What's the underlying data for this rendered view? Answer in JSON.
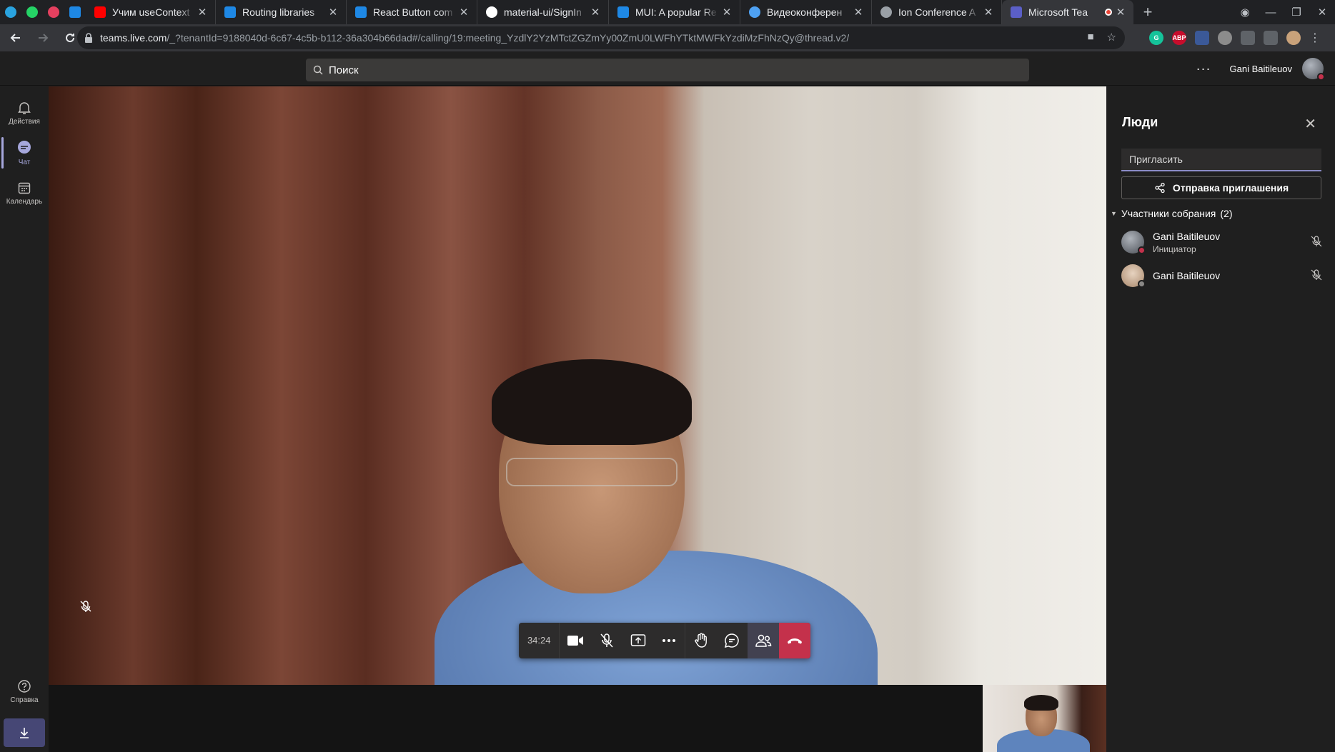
{
  "browser": {
    "pinned_tabs": [
      {
        "icon": "telegram-icon",
        "color": "#2aa3df"
      },
      {
        "icon": "whatsapp-icon",
        "color": "#25d366"
      },
      {
        "icon": "recorder-icon",
        "color": "#e4405f"
      },
      {
        "icon": "mui-icon",
        "color": "#1e88e5"
      }
    ],
    "tabs": [
      {
        "title": "Учим useContext",
        "icon": "youtube-icon",
        "color": "#ff0000"
      },
      {
        "title": "Routing libraries",
        "icon": "mui-icon",
        "color": "#1e88e5"
      },
      {
        "title": "React Button com",
        "icon": "mui-icon",
        "color": "#1e88e5"
      },
      {
        "title": "material-ui/SignIn",
        "icon": "github-icon",
        "color": "#ffffff"
      },
      {
        "title": "MUI: A popular Re",
        "icon": "mui-icon",
        "color": "#1e88e5"
      },
      {
        "title": "Видеоконферен",
        "icon": "videoconf-icon",
        "color": "#4ea1f3"
      },
      {
        "title": "Ion Conference A",
        "icon": "globe-icon",
        "color": "#9aa0a6"
      },
      {
        "title": "Microsoft Tea",
        "icon": "teams-icon",
        "color": "#5b5fc7",
        "active": true
      }
    ],
    "url_host": "teams.live.com",
    "url_path": "/_?tenantId=9188040d-6c67-4c5b-b112-36a304b66dad#/calling/19:meeting_YzdlY2YzMTctZGZmYy00ZmU0LWFhYTktMWFkYzdiMzFhNzQy@thread.v2/",
    "extensions": [
      {
        "icon": "grammarly-icon",
        "label": "G",
        "color": "#15c39a"
      },
      {
        "icon": "adblock-icon",
        "label": "ABP",
        "color": "#c70d2c"
      },
      {
        "icon": "devtools-icon",
        "label": "",
        "color": "#3b5998"
      },
      {
        "icon": "timer-icon",
        "label": "",
        "color": "#8c8c8c"
      },
      {
        "icon": "eyedropper-icon",
        "label": "",
        "color": "#5f6368"
      },
      {
        "icon": "puzzle-icon",
        "label": "",
        "color": "#5f6368"
      }
    ]
  },
  "teams": {
    "search_placeholder": "Поиск",
    "user_name": "Gani Baitileuov",
    "rail": [
      {
        "label": "Действия",
        "icon": "bell-icon"
      },
      {
        "label": "Чат",
        "icon": "chat-icon",
        "active": true
      },
      {
        "label": "Календарь",
        "icon": "calendar-icon"
      }
    ],
    "help_label": "Справка",
    "call": {
      "timer": "34:24"
    },
    "people": {
      "title": "Люди",
      "invite_placeholder": "Пригласить",
      "send_invite": "Отправка приглашения",
      "section_label": "Участники собрания",
      "section_count": "(2)",
      "members": [
        {
          "name": "Gani Baitileuov",
          "role": "Инициатор",
          "status_color": "#c4314b"
        },
        {
          "name": "Gani Baitileuov",
          "role": "",
          "status_color": "#8a8886"
        }
      ]
    }
  }
}
